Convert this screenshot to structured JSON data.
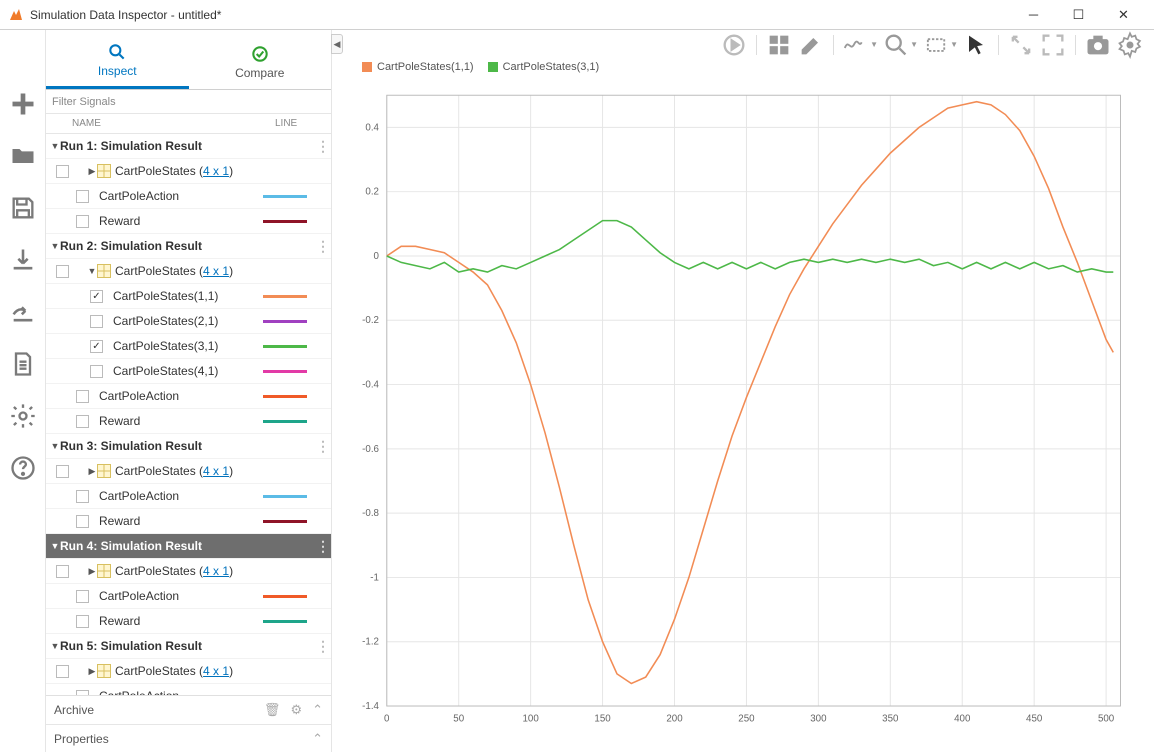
{
  "window": {
    "title": "Simulation Data Inspector - untitled*"
  },
  "tabs": {
    "inspect": "Inspect",
    "compare": "Compare"
  },
  "filter_placeholder": "Filter Signals",
  "header": {
    "name": "NAME",
    "line": "LINE"
  },
  "footer": {
    "archive": "Archive",
    "properties": "Properties"
  },
  "runs": [
    {
      "id": "run1",
      "label": "Run 1: Simulation Result",
      "expanded": true,
      "selected": false,
      "children": [
        {
          "type": "group",
          "label": "CartPoleStates",
          "dims": "4 x 1",
          "expanded": false
        },
        {
          "type": "signal",
          "label": "CartPoleAction",
          "color": "#5bbbe6"
        },
        {
          "type": "signal",
          "label": "Reward",
          "color": "#8f1428"
        }
      ]
    },
    {
      "id": "run2",
      "label": "Run 2: Simulation Result",
      "expanded": true,
      "children": [
        {
          "type": "group",
          "label": "CartPoleStates",
          "dims": "4 x 1",
          "expanded": true,
          "children": [
            {
              "type": "sub",
              "label": "CartPoleStates(1,1)",
              "color": "#f28c55",
              "checked": true
            },
            {
              "type": "sub",
              "label": "CartPoleStates(2,1)",
              "color": "#a040c0"
            },
            {
              "type": "sub",
              "label": "CartPoleStates(3,1)",
              "color": "#4db848",
              "checked": true
            },
            {
              "type": "sub",
              "label": "CartPoleStates(4,1)",
              "color": "#e23aa6"
            }
          ]
        },
        {
          "type": "signal",
          "label": "CartPoleAction",
          "color": "#f05a28"
        },
        {
          "type": "signal",
          "label": "Reward",
          "color": "#1ea58a"
        }
      ]
    },
    {
      "id": "run3",
      "label": "Run 3: Simulation Result",
      "expanded": true,
      "children": [
        {
          "type": "group",
          "label": "CartPoleStates",
          "dims": "4 x 1",
          "expanded": false
        },
        {
          "type": "signal",
          "label": "CartPoleAction",
          "color": "#5bbbe6"
        },
        {
          "type": "signal",
          "label": "Reward",
          "color": "#8f1428"
        }
      ]
    },
    {
      "id": "run4",
      "label": "Run 4: Simulation Result",
      "expanded": true,
      "selected": true,
      "children": [
        {
          "type": "group",
          "label": "CartPoleStates",
          "dims": "4 x 1",
          "expanded": false
        },
        {
          "type": "signal",
          "label": "CartPoleAction",
          "color": "#f05a28"
        },
        {
          "type": "signal",
          "label": "Reward",
          "color": "#1ea58a"
        }
      ]
    },
    {
      "id": "run5",
      "label": "Run 5: Simulation Result",
      "expanded": true,
      "children": [
        {
          "type": "group",
          "label": "CartPoleStates",
          "dims": "4 x 1",
          "expanded": false
        },
        {
          "type": "signal",
          "label": "CartPoleAction",
          "color": "#5bbbe6"
        }
      ]
    }
  ],
  "chart_data": {
    "type": "line",
    "xlim": [
      0,
      510
    ],
    "ylim": [
      -1.4,
      0.5
    ],
    "xticks": [
      0,
      50,
      100,
      150,
      200,
      250,
      300,
      350,
      400,
      450,
      500
    ],
    "yticks": [
      0.4,
      0.2,
      0,
      -0.2,
      -0.4,
      -0.6,
      -0.8,
      -1.0,
      -1.2,
      -1.4
    ],
    "series": [
      {
        "name": "CartPoleStates(1,1)",
        "color": "#f28c55",
        "data": [
          [
            0,
            0.0
          ],
          [
            10,
            0.03
          ],
          [
            20,
            0.03
          ],
          [
            30,
            0.02
          ],
          [
            40,
            0.01
          ],
          [
            50,
            -0.02
          ],
          [
            60,
            -0.05
          ],
          [
            70,
            -0.09
          ],
          [
            80,
            -0.17
          ],
          [
            90,
            -0.27
          ],
          [
            100,
            -0.4
          ],
          [
            110,
            -0.55
          ],
          [
            120,
            -0.72
          ],
          [
            130,
            -0.9
          ],
          [
            140,
            -1.07
          ],
          [
            150,
            -1.2
          ],
          [
            160,
            -1.3
          ],
          [
            170,
            -1.33
          ],
          [
            180,
            -1.31
          ],
          [
            190,
            -1.24
          ],
          [
            200,
            -1.13
          ],
          [
            210,
            -1.0
          ],
          [
            220,
            -0.85
          ],
          [
            230,
            -0.7
          ],
          [
            240,
            -0.56
          ],
          [
            250,
            -0.44
          ],
          [
            260,
            -0.33
          ],
          [
            270,
            -0.22
          ],
          [
            280,
            -0.12
          ],
          [
            290,
            -0.04
          ],
          [
            300,
            0.03
          ],
          [
            310,
            0.1
          ],
          [
            320,
            0.16
          ],
          [
            330,
            0.22
          ],
          [
            340,
            0.27
          ],
          [
            350,
            0.32
          ],
          [
            360,
            0.36
          ],
          [
            370,
            0.4
          ],
          [
            380,
            0.43
          ],
          [
            390,
            0.46
          ],
          [
            400,
            0.47
          ],
          [
            410,
            0.48
          ],
          [
            420,
            0.47
          ],
          [
            430,
            0.44
          ],
          [
            440,
            0.39
          ],
          [
            450,
            0.31
          ],
          [
            460,
            0.21
          ],
          [
            470,
            0.09
          ],
          [
            480,
            -0.02
          ],
          [
            490,
            -0.14
          ],
          [
            500,
            -0.26
          ],
          [
            505,
            -0.3
          ]
        ]
      },
      {
        "name": "CartPoleStates(3,1)",
        "color": "#4db848",
        "data": [
          [
            0,
            0.0
          ],
          [
            10,
            -0.02
          ],
          [
            20,
            -0.03
          ],
          [
            30,
            -0.04
          ],
          [
            40,
            -0.02
          ],
          [
            50,
            -0.05
          ],
          [
            60,
            -0.04
          ],
          [
            70,
            -0.05
          ],
          [
            80,
            -0.03
          ],
          [
            90,
            -0.04
          ],
          [
            100,
            -0.02
          ],
          [
            110,
            0.0
          ],
          [
            120,
            0.02
          ],
          [
            130,
            0.05
          ],
          [
            140,
            0.08
          ],
          [
            150,
            0.11
          ],
          [
            160,
            0.11
          ],
          [
            170,
            0.09
          ],
          [
            180,
            0.05
          ],
          [
            190,
            0.01
          ],
          [
            200,
            -0.02
          ],
          [
            210,
            -0.04
          ],
          [
            220,
            -0.02
          ],
          [
            230,
            -0.04
          ],
          [
            240,
            -0.02
          ],
          [
            250,
            -0.04
          ],
          [
            260,
            -0.02
          ],
          [
            270,
            -0.04
          ],
          [
            280,
            -0.02
          ],
          [
            290,
            -0.01
          ],
          [
            300,
            -0.02
          ],
          [
            310,
            -0.01
          ],
          [
            320,
            -0.02
          ],
          [
            330,
            -0.01
          ],
          [
            340,
            -0.02
          ],
          [
            350,
            -0.01
          ],
          [
            360,
            -0.02
          ],
          [
            370,
            -0.01
          ],
          [
            380,
            -0.03
          ],
          [
            390,
            -0.02
          ],
          [
            400,
            -0.04
          ],
          [
            410,
            -0.02
          ],
          [
            420,
            -0.04
          ],
          [
            430,
            -0.02
          ],
          [
            440,
            -0.04
          ],
          [
            450,
            -0.02
          ],
          [
            460,
            -0.04
          ],
          [
            470,
            -0.03
          ],
          [
            480,
            -0.05
          ],
          [
            490,
            -0.04
          ],
          [
            500,
            -0.05
          ],
          [
            505,
            -0.05
          ]
        ]
      }
    ]
  }
}
